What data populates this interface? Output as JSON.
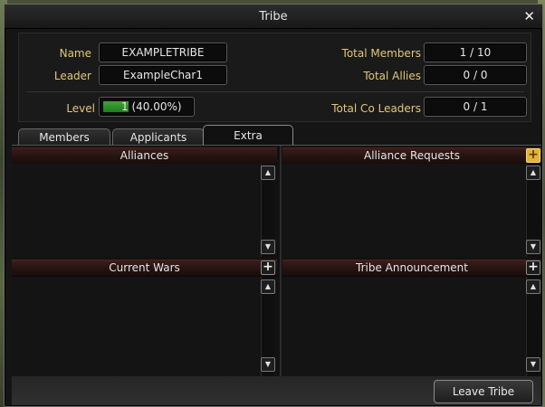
{
  "window": {
    "title": "Tribe",
    "close": "✕"
  },
  "info": {
    "name_label": "Name",
    "name_value": "EXAMPLETRIBE",
    "leader_label": "Leader",
    "leader_value": "ExampleChar1",
    "level_label": "Level",
    "level_value": "1 (40.00%)",
    "level_progress": 0.4,
    "total_members_label": "Total Members",
    "total_members_value": "1 / 10",
    "total_allies_label": "Total Allies",
    "total_allies_value": "0 / 0",
    "total_co_leaders_label": "Total Co Leaders",
    "total_co_leaders_value": "0 / 1"
  },
  "tabs": [
    {
      "label": "Members",
      "active": false
    },
    {
      "label": "Applicants",
      "active": false
    },
    {
      "label": "Extra",
      "active": true
    }
  ],
  "sections": {
    "alliances": "Alliances",
    "alliance_requests": "Alliance Requests",
    "current_wars": "Current Wars",
    "tribe_announcement": "Tribe Announcement"
  },
  "icons": {
    "scroll_up": "scroll-up-icon",
    "scroll_down": "scroll-down-icon",
    "plus": "plus-icon"
  },
  "colors": {
    "label_gold": "#e2c778",
    "accent_gold": "#e3b339",
    "level_green": "#3fa43a",
    "header_red": "#3a1d1a"
  },
  "footer": {
    "leave_button": "Leave Tribe"
  }
}
